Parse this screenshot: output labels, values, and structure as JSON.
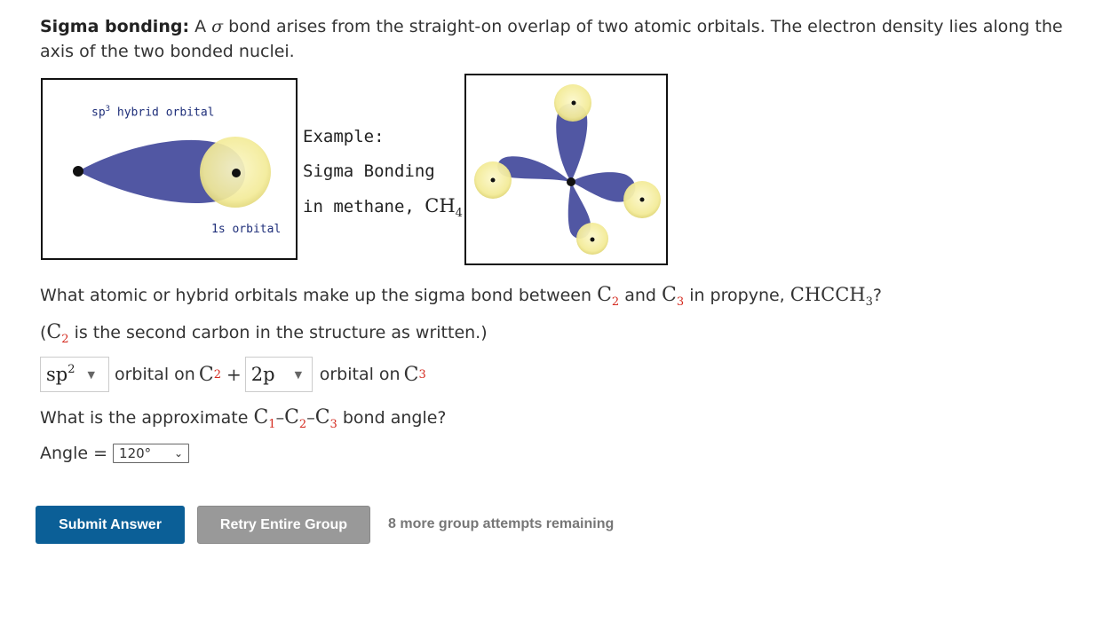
{
  "intro": {
    "bold": "Sigma bonding:",
    "text_a": " A ",
    "sigma": "σ",
    "text_b": " bond arises from the straight-on overlap of two atomic orbitals. The electron density lies along the axis of the two bonded nuclei."
  },
  "figure1": {
    "label_sp3": "sp",
    "label_sp3_sup": "3",
    "label_sp3_rest": " hybrid orbital",
    "label_1s": "1s orbital"
  },
  "example": {
    "line1": "Example:",
    "line2": "Sigma Bonding",
    "line3_text": "in methane, ",
    "line3_formula": "CH",
    "line3_sub": "4"
  },
  "question1": {
    "prefix": "What atomic or hybrid orbitals make up the sigma bond between ",
    "c_a": "C",
    "c_a_sub": "2",
    "mid": " and ",
    "c_b": "C",
    "c_b_sub": "3",
    "suffix": " in propyne, ",
    "formula": "CHCCH",
    "formula_sub": "3",
    "end": "?"
  },
  "question2": {
    "open": "(",
    "c": "C",
    "c_sub": "2",
    "rest": " is the second carbon in the structure as written.)"
  },
  "orbital_row": {
    "select1_value": "sp",
    "select1_sup": "2",
    "text_on1": "orbital on ",
    "c1": "C",
    "c1_sub": "2",
    "plus": "+",
    "select2_value": "2p",
    "text_on2": "orbital on ",
    "c2": "C",
    "c2_sub": "3"
  },
  "question3": {
    "prefix": "What is the approximate ",
    "c1": "C",
    "c1_sub": "1",
    "dash1": "–",
    "c2": "C",
    "c2_sub": "2",
    "dash2": "–",
    "c3": "C",
    "c3_sub": "3",
    "suffix": " bond angle?"
  },
  "angle": {
    "label": "Angle = ",
    "value": "120°"
  },
  "buttons": {
    "submit": "Submit Answer",
    "retry": "Retry Entire Group",
    "attempts": "8 more group attempts remaining"
  },
  "colors": {
    "lobe": "#5157a3",
    "s_orbital": "#f6f0a6",
    "submit_bg": "#0b5f97",
    "retry_bg": "#999999",
    "subscript_red": "#d42a1f"
  }
}
